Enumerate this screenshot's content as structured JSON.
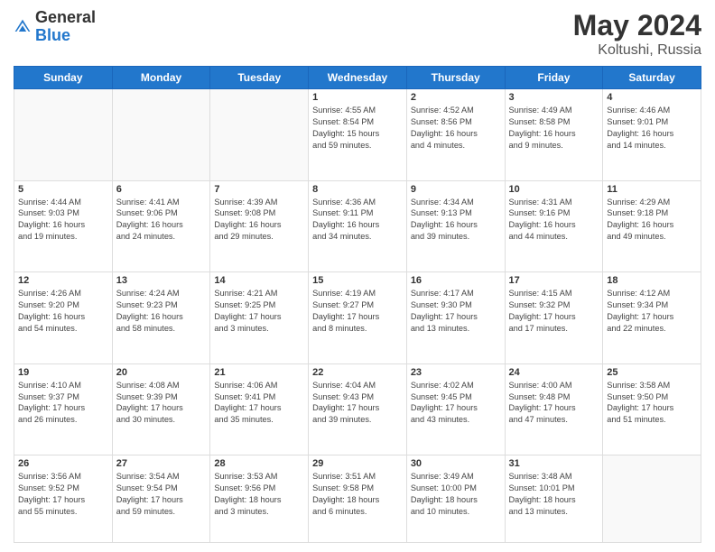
{
  "header": {
    "logo_general": "General",
    "logo_blue": "Blue",
    "title": "May 2024",
    "location": "Koltushi, Russia"
  },
  "days_of_week": [
    "Sunday",
    "Monday",
    "Tuesday",
    "Wednesday",
    "Thursday",
    "Friday",
    "Saturday"
  ],
  "weeks": [
    [
      {
        "day": "",
        "info": ""
      },
      {
        "day": "",
        "info": ""
      },
      {
        "day": "",
        "info": ""
      },
      {
        "day": "1",
        "info": "Sunrise: 4:55 AM\nSunset: 8:54 PM\nDaylight: 15 hours\nand 59 minutes."
      },
      {
        "day": "2",
        "info": "Sunrise: 4:52 AM\nSunset: 8:56 PM\nDaylight: 16 hours\nand 4 minutes."
      },
      {
        "day": "3",
        "info": "Sunrise: 4:49 AM\nSunset: 8:58 PM\nDaylight: 16 hours\nand 9 minutes."
      },
      {
        "day": "4",
        "info": "Sunrise: 4:46 AM\nSunset: 9:01 PM\nDaylight: 16 hours\nand 14 minutes."
      }
    ],
    [
      {
        "day": "5",
        "info": "Sunrise: 4:44 AM\nSunset: 9:03 PM\nDaylight: 16 hours\nand 19 minutes."
      },
      {
        "day": "6",
        "info": "Sunrise: 4:41 AM\nSunset: 9:06 PM\nDaylight: 16 hours\nand 24 minutes."
      },
      {
        "day": "7",
        "info": "Sunrise: 4:39 AM\nSunset: 9:08 PM\nDaylight: 16 hours\nand 29 minutes."
      },
      {
        "day": "8",
        "info": "Sunrise: 4:36 AM\nSunset: 9:11 PM\nDaylight: 16 hours\nand 34 minutes."
      },
      {
        "day": "9",
        "info": "Sunrise: 4:34 AM\nSunset: 9:13 PM\nDaylight: 16 hours\nand 39 minutes."
      },
      {
        "day": "10",
        "info": "Sunrise: 4:31 AM\nSunset: 9:16 PM\nDaylight: 16 hours\nand 44 minutes."
      },
      {
        "day": "11",
        "info": "Sunrise: 4:29 AM\nSunset: 9:18 PM\nDaylight: 16 hours\nand 49 minutes."
      }
    ],
    [
      {
        "day": "12",
        "info": "Sunrise: 4:26 AM\nSunset: 9:20 PM\nDaylight: 16 hours\nand 54 minutes."
      },
      {
        "day": "13",
        "info": "Sunrise: 4:24 AM\nSunset: 9:23 PM\nDaylight: 16 hours\nand 58 minutes."
      },
      {
        "day": "14",
        "info": "Sunrise: 4:21 AM\nSunset: 9:25 PM\nDaylight: 17 hours\nand 3 minutes."
      },
      {
        "day": "15",
        "info": "Sunrise: 4:19 AM\nSunset: 9:27 PM\nDaylight: 17 hours\nand 8 minutes."
      },
      {
        "day": "16",
        "info": "Sunrise: 4:17 AM\nSunset: 9:30 PM\nDaylight: 17 hours\nand 13 minutes."
      },
      {
        "day": "17",
        "info": "Sunrise: 4:15 AM\nSunset: 9:32 PM\nDaylight: 17 hours\nand 17 minutes."
      },
      {
        "day": "18",
        "info": "Sunrise: 4:12 AM\nSunset: 9:34 PM\nDaylight: 17 hours\nand 22 minutes."
      }
    ],
    [
      {
        "day": "19",
        "info": "Sunrise: 4:10 AM\nSunset: 9:37 PM\nDaylight: 17 hours\nand 26 minutes."
      },
      {
        "day": "20",
        "info": "Sunrise: 4:08 AM\nSunset: 9:39 PM\nDaylight: 17 hours\nand 30 minutes."
      },
      {
        "day": "21",
        "info": "Sunrise: 4:06 AM\nSunset: 9:41 PM\nDaylight: 17 hours\nand 35 minutes."
      },
      {
        "day": "22",
        "info": "Sunrise: 4:04 AM\nSunset: 9:43 PM\nDaylight: 17 hours\nand 39 minutes."
      },
      {
        "day": "23",
        "info": "Sunrise: 4:02 AM\nSunset: 9:45 PM\nDaylight: 17 hours\nand 43 minutes."
      },
      {
        "day": "24",
        "info": "Sunrise: 4:00 AM\nSunset: 9:48 PM\nDaylight: 17 hours\nand 47 minutes."
      },
      {
        "day": "25",
        "info": "Sunrise: 3:58 AM\nSunset: 9:50 PM\nDaylight: 17 hours\nand 51 minutes."
      }
    ],
    [
      {
        "day": "26",
        "info": "Sunrise: 3:56 AM\nSunset: 9:52 PM\nDaylight: 17 hours\nand 55 minutes."
      },
      {
        "day": "27",
        "info": "Sunrise: 3:54 AM\nSunset: 9:54 PM\nDaylight: 17 hours\nand 59 minutes."
      },
      {
        "day": "28",
        "info": "Sunrise: 3:53 AM\nSunset: 9:56 PM\nDaylight: 18 hours\nand 3 minutes."
      },
      {
        "day": "29",
        "info": "Sunrise: 3:51 AM\nSunset: 9:58 PM\nDaylight: 18 hours\nand 6 minutes."
      },
      {
        "day": "30",
        "info": "Sunrise: 3:49 AM\nSunset: 10:00 PM\nDaylight: 18 hours\nand 10 minutes."
      },
      {
        "day": "31",
        "info": "Sunrise: 3:48 AM\nSunset: 10:01 PM\nDaylight: 18 hours\nand 13 minutes."
      },
      {
        "day": "",
        "info": ""
      }
    ]
  ]
}
